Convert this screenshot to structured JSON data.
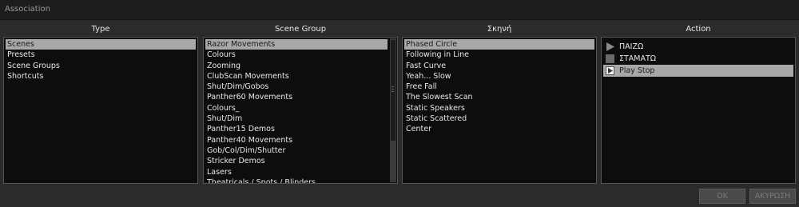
{
  "window": {
    "title": "Association"
  },
  "columns": {
    "type": {
      "header": "Type",
      "items": [
        "Scenes",
        "Presets",
        "Scene Groups",
        "Shortcuts"
      ],
      "selected_index": 0
    },
    "scene_group": {
      "header": "Scene Group",
      "items": [
        "Razor Movements",
        "Colours",
        "Zooming",
        "ClubScan Movements",
        "Shut/Dim/Gobos",
        "Panther60 Movements",
        "Colours_",
        "Shut/Dim",
        "Panther15 Demos",
        "Panther40 Movements",
        "Gob/Col/Dim/Shutter",
        "Stricker Demos",
        "Lasers",
        "Theatricals / Spots / Blinders"
      ],
      "selected_index": 0
    },
    "scene": {
      "header": "Σκηνή",
      "items": [
        "Phased Circle",
        "Following in Line",
        "Fast Curve",
        "Yeah... Slow",
        "Free Fall",
        "The Slowest Scan",
        "Static Speakers",
        "Static Scattered",
        "Center"
      ],
      "selected_index": 0
    },
    "action": {
      "header": "Action",
      "items": [
        {
          "label": "ΠΑΙΖΩ",
          "icon": "play-icon"
        },
        {
          "label": "ΣΤΑΜΑΤΩ",
          "icon": "stop-icon"
        },
        {
          "label": "Play Stop",
          "icon": "play-stop-icon"
        }
      ],
      "selected_index": 2
    }
  },
  "buttons": {
    "ok": "OK",
    "cancel": "ΑΚΥΡΩΣΗ"
  },
  "colors": {
    "background": "#2b2b2b",
    "list_background": "#0d0d0d",
    "selection": "#a8a8a8",
    "title_bar": "#1c1c1c"
  }
}
